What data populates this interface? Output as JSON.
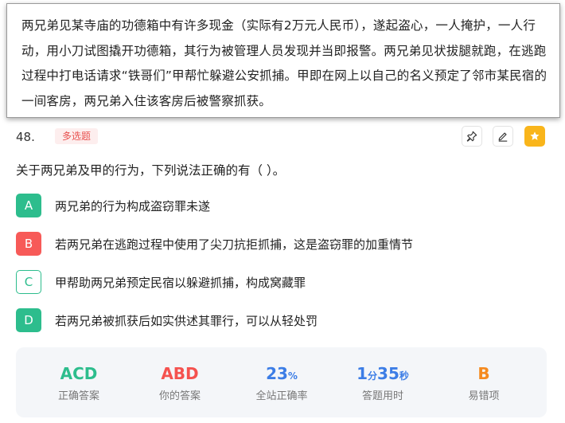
{
  "passage": {
    "lines": [
      "两兄弟见某寺庙的功德箱中有许多现金（实际有2万元人民币），遂起盗心，一人掩护，一人行",
      "动，用小刀试图撬开功德箱，其行为被管理人员发现并当即报警。两兄弟见状拔腿就跑，在逃跑",
      "过程中打电话请求“铁哥们”甲帮忙躲避公安抓捕。甲即在网上以自己的名义预定了邻市某民宿的",
      "一间客房，两兄弟入住该客房后被警察抓获。"
    ]
  },
  "question": {
    "number": "48.",
    "type": "多选题",
    "stem": "关于两兄弟及甲的行为，下列说法正确的有（ ）。"
  },
  "options": [
    {
      "letter": "A",
      "text": "两兄弟的行为构成盗窃罪未遂",
      "state": "correct"
    },
    {
      "letter": "B",
      "text": "若两兄弟在逃跑过程中使用了尖刀抗拒抓捕，这是盗窃罪的加重情节",
      "state": "wrong"
    },
    {
      "letter": "C",
      "text": "甲帮助两兄弟预定民宿以躲避抓捕，构成窝藏罪",
      "state": "missed"
    },
    {
      "letter": "D",
      "text": "若两兄弟被抓获后如实供述其罪行，可以从轻处罚",
      "state": "correct"
    }
  ],
  "stats": {
    "correct_answer": {
      "value": "ACD",
      "label": "正确答案"
    },
    "your_answer": {
      "value": "ABD",
      "label": "你的答案"
    },
    "accuracy": {
      "value": "23",
      "unit": "%",
      "label": "全站正确率"
    },
    "time": {
      "min": "1",
      "min_unit": "分",
      "sec": "35",
      "sec_unit": "秒",
      "label": "答题用时"
    },
    "easy_wrong": {
      "value": "B",
      "label": "易错项"
    }
  },
  "colors": {
    "correct": "#2dbd8d",
    "wrong": "#f75a58",
    "blue": "#3c7de6",
    "orange": "#f58a1f",
    "star": "#f9b51b"
  },
  "icons": [
    "pin-icon",
    "edit-icon",
    "star-icon"
  ]
}
